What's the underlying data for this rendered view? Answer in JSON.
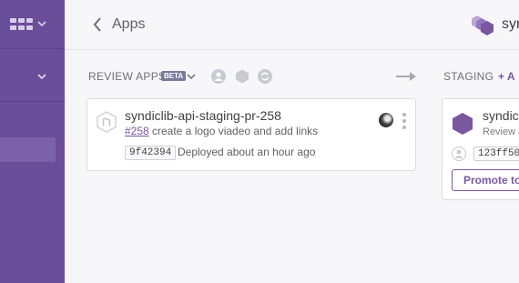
{
  "header": {
    "title": "Apps",
    "app_name": "syr"
  },
  "pipeline": {
    "review_apps": {
      "label": "REVIEW APPS",
      "badge": "BETA"
    },
    "staging": {
      "label": "STAGING",
      "add_label": "+ A"
    }
  },
  "review_card": {
    "app_name": "syndiclib-api-staging-pr-258",
    "pr_number": "#258",
    "pr_title": "create a logo viadeo and add links",
    "commit_sha": "9f42394",
    "deploy_status": "Deployed about an hour ago"
  },
  "staging_card": {
    "app_name": "syndic",
    "subtitle": "Review a",
    "commit_sha": "123ff50",
    "promote_label": "Promote to"
  },
  "colors": {
    "sidebar": "#6b4e9a",
    "accent": "#79589f"
  },
  "icons": {
    "grid": "grid-icon",
    "back": "chevron-left-icon",
    "app": "hexagon-stack-icon",
    "kebab": "more-vertical-icon"
  }
}
